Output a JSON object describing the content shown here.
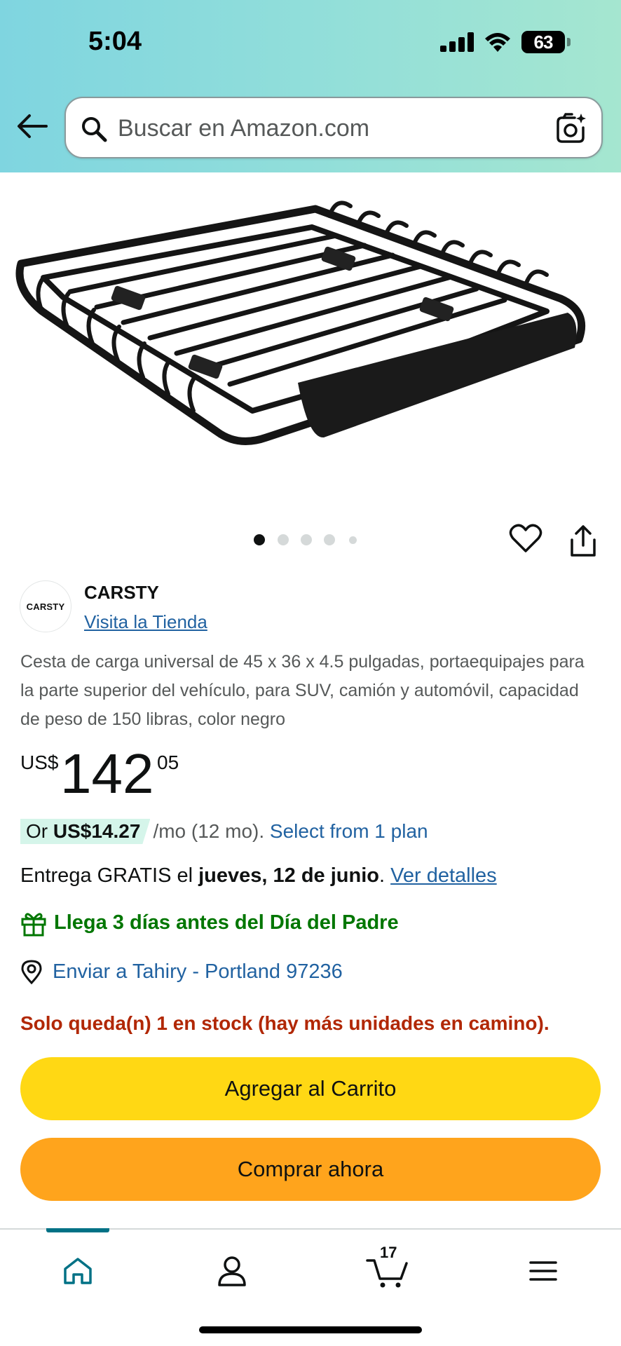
{
  "status_bar": {
    "time": "5:04",
    "battery": "63"
  },
  "search": {
    "placeholder": "Buscar en Amazon.com"
  },
  "product": {
    "brand_logo_text": "CARSTY",
    "brand_name": "CARSTY",
    "store_link": "Visita la Tienda",
    "title": "Cesta de carga universal de 45 x 36 x 4.5 pulgadas, portaequipajes para la parte superior del vehículo, para SUV, camión y automóvil, capacidad de peso de 150 libras, color negro",
    "image_count": 5,
    "active_image": 1,
    "price": {
      "currency": "US$",
      "whole": "142",
      "fraction": "05"
    },
    "installment": {
      "prefix": "Or",
      "amount": "US$14.27",
      "term": "/mo (12 mo).",
      "link": "Select from 1 plan"
    },
    "delivery": {
      "prefix": "Entrega GRATIS el",
      "date": "jueves, 12 de junio",
      "suffix": ".",
      "link": "Ver detalles"
    },
    "gift_message": "Llega 3 días antes del Día del Padre",
    "ship_to": "Enviar a Tahiry - Portland 97236",
    "stock": "Solo queda(n) 1 en stock (hay más unidades en camino)."
  },
  "buttons": {
    "add_to_cart": "Agregar al Carrito",
    "buy_now": "Comprar ahora"
  },
  "bottom_nav": {
    "items": [
      "home-icon",
      "account-icon",
      "cart-icon",
      "menu-icon"
    ],
    "active": "home",
    "cart_count": "17"
  },
  "colors": {
    "header_gradient_start": "#7fd5e0",
    "header_gradient_end": "#a5e6d0",
    "link": "#2162a1",
    "green": "#007600",
    "stock_red": "#b12704",
    "add_to_cart": "#ffd814",
    "buy_now": "#ffa41c",
    "nav_active": "#007185"
  }
}
